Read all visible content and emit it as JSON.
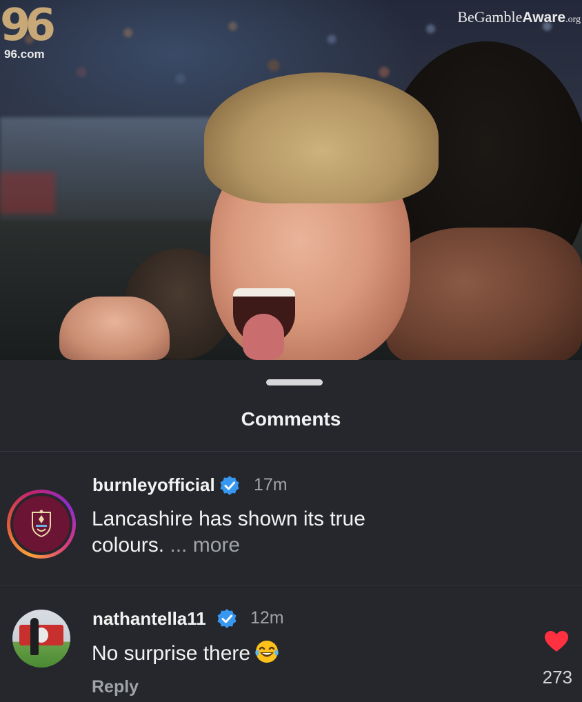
{
  "header": {
    "logo_number": "96",
    "logo_site": "96.com",
    "gamble_be": "Be",
    "gamble_gamble": "Gamble",
    "gamble_aware": "Aware",
    "gamble_org": ".org"
  },
  "comments_sheet": {
    "title": "Comments",
    "comments": [
      {
        "username": "burnleyofficial",
        "verified": true,
        "time": "17m",
        "text_line1": "Lancashire has shown its true",
        "text_line2": "colours.",
        "more_label": "... more"
      },
      {
        "username": "nathantella11",
        "verified": true,
        "time": "12m",
        "text": "No surprise there",
        "emoji": "face-with-tears-of-joy",
        "reply_label": "Reply",
        "like_count": "273",
        "liked": true
      }
    ]
  },
  "colors": {
    "sheet_background": "#25272c",
    "verified_blue": "#3897f0",
    "heart_red": "#ff3040",
    "burnley_claret": "#6b1434"
  }
}
